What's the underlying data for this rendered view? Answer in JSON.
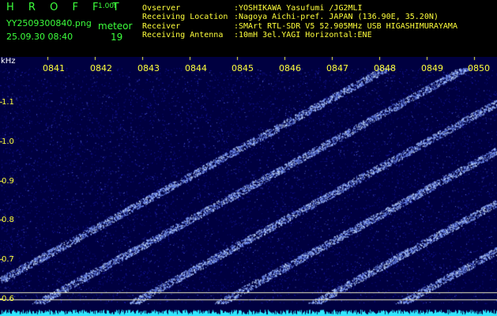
{
  "header": {
    "brand": "H R O F F T",
    "version": "1.00f",
    "filename": "YY2509300840.png",
    "meteor_label": "meteor",
    "datetime": "25.09.30 08:40",
    "meteor_count": "19"
  },
  "info": [
    {
      "label": "Ovserver",
      "value": ":YOSHIKAWA Yasufumi /JG2MLI"
    },
    {
      "label": "Receiving Location",
      "value": ":Nagoya Aichi-pref. JAPAN (136.90E, 35.20N)"
    },
    {
      "label": "Receiver",
      "value": ":SMArt RTL-SDR V5 52.905MHz USB HIGASHIMURAYAMA"
    },
    {
      "label": "Receiving Antenna",
      "value": ":10mH 3el.YAGI Horizontal:ENE"
    }
  ],
  "spectrogram": {
    "unit_label": "kHz",
    "y_ticks": [
      "1.1",
      "1.0",
      "0.9",
      "0.8",
      "0.7",
      "0.6"
    ],
    "x_ticks": [
      "0841",
      "0842",
      "0843",
      "0844",
      "0845",
      "0846",
      "0847",
      "0848",
      "0849",
      "0850"
    ],
    "colors": {
      "background": "#000040",
      "noise": "#1a1adc",
      "trace": "#cfe6ff",
      "baseline": "#30e8ff",
      "ref_line": "#e8e8c0",
      "ticks": "#ffff3c"
    }
  }
}
